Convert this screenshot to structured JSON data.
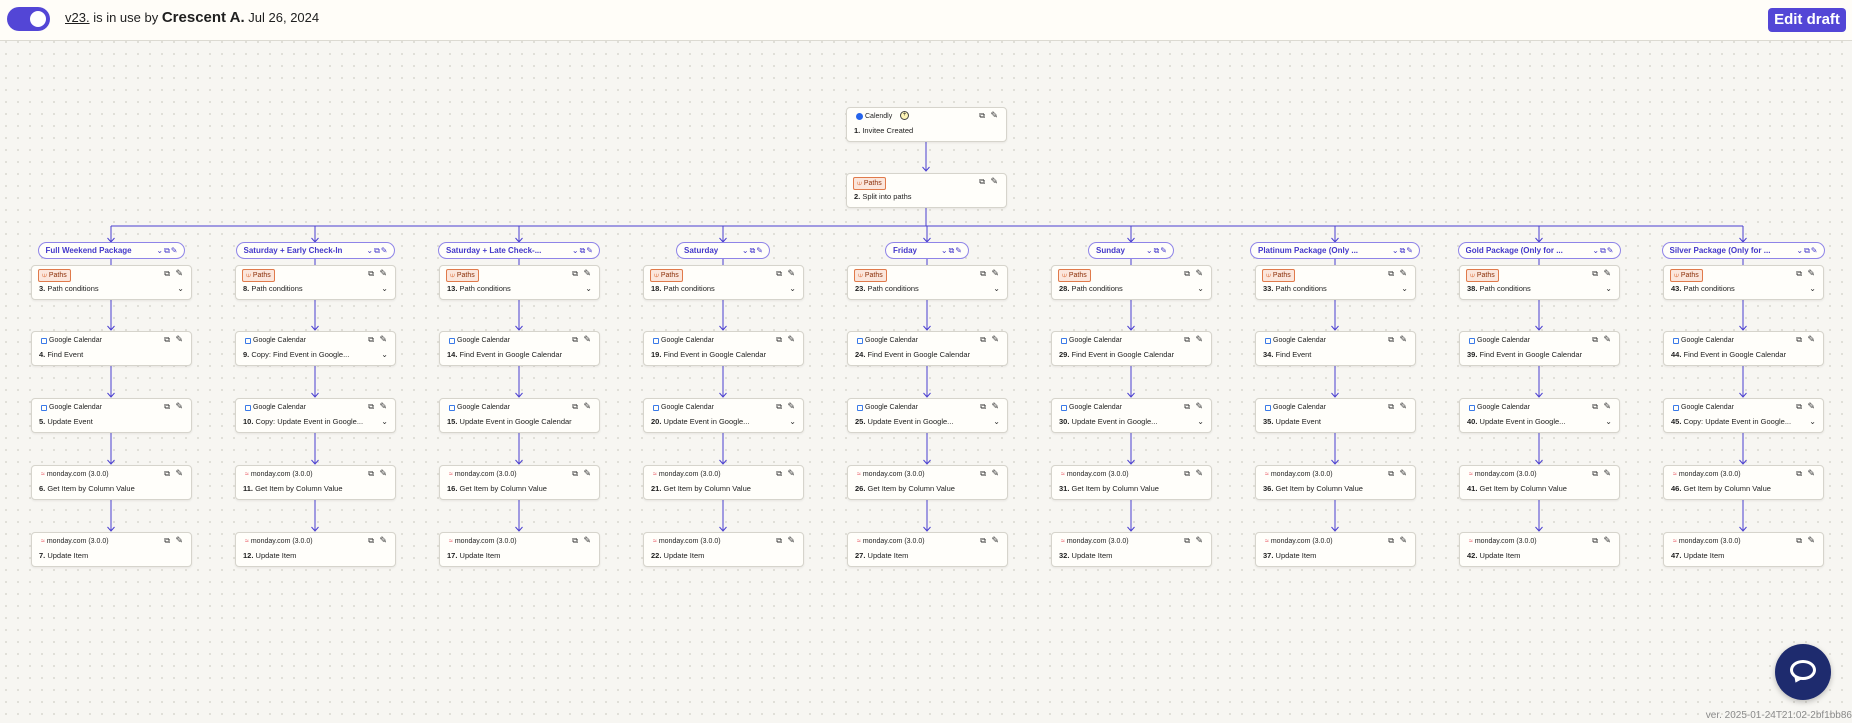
{
  "header": {
    "version": "v23.",
    "in_use_text": " is in use by ",
    "user": "Crescent A.",
    "date": "Jul 26, 2024",
    "edit_button": "Edit draft"
  },
  "colors": {
    "accent": "#5346d6",
    "branch_text": "#4338ca",
    "paths_orange": "#e07a4b"
  },
  "trigger": {
    "app": "Calendly",
    "app_icon": "calendly-icon",
    "num": "1.",
    "title": "Invitee Created"
  },
  "splitter": {
    "app": "Paths",
    "app_icon": "paths-icon",
    "num": "2.",
    "title": "Split into paths"
  },
  "branches": [
    {
      "name": "Full Weekend Package",
      "steps": [
        {
          "app": "Paths",
          "num": "3.",
          "title": "Path conditions",
          "chevron": true
        },
        {
          "app": "Google Calendar",
          "num": "4.",
          "title": "Find Event",
          "chevron": false
        },
        {
          "app": "Google Calendar",
          "num": "5.",
          "title": "Update Event",
          "chevron": false
        },
        {
          "app": "monday.com (3.0.0)",
          "num": "6.",
          "title": "Get Item by Column Value",
          "chevron": false
        },
        {
          "app": "monday.com (3.0.0)",
          "num": "7.",
          "title": "Update Item",
          "chevron": false
        }
      ]
    },
    {
      "name": "Saturday + Early Check-In",
      "steps": [
        {
          "app": "Paths",
          "num": "8.",
          "title": "Path conditions",
          "chevron": true
        },
        {
          "app": "Google Calendar",
          "num": "9.",
          "title": "Copy: Find Event in Google...",
          "chevron": true
        },
        {
          "app": "Google Calendar",
          "num": "10.",
          "title": "Copy: Update Event in Google...",
          "chevron": true
        },
        {
          "app": "monday.com (3.0.0)",
          "num": "11.",
          "title": "Get Item by Column Value",
          "chevron": false
        },
        {
          "app": "monday.com (3.0.0)",
          "num": "12.",
          "title": "Update Item",
          "chevron": false
        }
      ]
    },
    {
      "name": "Saturday + Late Check-...",
      "steps": [
        {
          "app": "Paths",
          "num": "13.",
          "title": "Path conditions",
          "chevron": true
        },
        {
          "app": "Google Calendar",
          "num": "14.",
          "title": "Find Event in Google Calendar",
          "chevron": false
        },
        {
          "app": "Google Calendar",
          "num": "15.",
          "title": "Update Event in Google Calendar",
          "chevron": false
        },
        {
          "app": "monday.com (3.0.0)",
          "num": "16.",
          "title": "Get Item by Column Value",
          "chevron": false
        },
        {
          "app": "monday.com (3.0.0)",
          "num": "17.",
          "title": "Update Item",
          "chevron": false
        }
      ]
    },
    {
      "name": "Saturday",
      "steps": [
        {
          "app": "Paths",
          "num": "18.",
          "title": "Path conditions",
          "chevron": true
        },
        {
          "app": "Google Calendar",
          "num": "19.",
          "title": "Find Event in Google Calendar",
          "chevron": false
        },
        {
          "app": "Google Calendar",
          "num": "20.",
          "title": "Update Event in Google...",
          "chevron": true
        },
        {
          "app": "monday.com (3.0.0)",
          "num": "21.",
          "title": "Get Item by Column Value",
          "chevron": false
        },
        {
          "app": "monday.com (3.0.0)",
          "num": "22.",
          "title": "Update Item",
          "chevron": false
        }
      ]
    },
    {
      "name": "Friday",
      "steps": [
        {
          "app": "Paths",
          "num": "23.",
          "title": "Path conditions",
          "chevron": true
        },
        {
          "app": "Google Calendar",
          "num": "24.",
          "title": "Find Event in Google Calendar",
          "chevron": false
        },
        {
          "app": "Google Calendar",
          "num": "25.",
          "title": "Update Event in Google...",
          "chevron": true
        },
        {
          "app": "monday.com (3.0.0)",
          "num": "26.",
          "title": "Get Item by Column Value",
          "chevron": false
        },
        {
          "app": "monday.com (3.0.0)",
          "num": "27.",
          "title": "Update Item",
          "chevron": false
        }
      ]
    },
    {
      "name": "Sunday",
      "steps": [
        {
          "app": "Paths",
          "num": "28.",
          "title": "Path conditions",
          "chevron": true
        },
        {
          "app": "Google Calendar",
          "num": "29.",
          "title": "Find Event in Google Calendar",
          "chevron": false
        },
        {
          "app": "Google Calendar",
          "num": "30.",
          "title": "Update Event in Google...",
          "chevron": true
        },
        {
          "app": "monday.com (3.0.0)",
          "num": "31.",
          "title": "Get Item by Column Value",
          "chevron": false
        },
        {
          "app": "monday.com (3.0.0)",
          "num": "32.",
          "title": "Update Item",
          "chevron": false
        }
      ]
    },
    {
      "name": "Platinum Package (Only ...",
      "steps": [
        {
          "app": "Paths",
          "num": "33.",
          "title": "Path conditions",
          "chevron": true
        },
        {
          "app": "Google Calendar",
          "num": "34.",
          "title": "Find Event",
          "chevron": false
        },
        {
          "app": "Google Calendar",
          "num": "35.",
          "title": "Update Event",
          "chevron": false
        },
        {
          "app": "monday.com (3.0.0)",
          "num": "36.",
          "title": "Get Item by Column Value",
          "chevron": false
        },
        {
          "app": "monday.com (3.0.0)",
          "num": "37.",
          "title": "Update Item",
          "chevron": false
        }
      ]
    },
    {
      "name": "Gold Package (Only for ...",
      "steps": [
        {
          "app": "Paths",
          "num": "38.",
          "title": "Path conditions",
          "chevron": true
        },
        {
          "app": "Google Calendar",
          "num": "39.",
          "title": "Find Event in Google Calendar",
          "chevron": false
        },
        {
          "app": "Google Calendar",
          "num": "40.",
          "title": "Update Event in Google...",
          "chevron": true
        },
        {
          "app": "monday.com (3.0.0)",
          "num": "41.",
          "title": "Get Item by Column Value",
          "chevron": false
        },
        {
          "app": "monday.com (3.0.0)",
          "num": "42.",
          "title": "Update Item",
          "chevron": false
        }
      ]
    },
    {
      "name": "Silver Package (Only for ...",
      "steps": [
        {
          "app": "Paths",
          "num": "43.",
          "title": "Path conditions",
          "chevron": true
        },
        {
          "app": "Google Calendar",
          "num": "44.",
          "title": "Find Event in Google Calendar",
          "chevron": false
        },
        {
          "app": "Google Calendar",
          "num": "45.",
          "title": "Copy: Update Event in Google...",
          "chevron": true
        },
        {
          "app": "monday.com (3.0.0)",
          "num": "46.",
          "title": "Get Item by Column Value",
          "chevron": false
        },
        {
          "app": "monday.com (3.0.0)",
          "num": "47.",
          "title": "Update Item",
          "chevron": false
        }
      ]
    }
  ],
  "footer": {
    "version_stamp": "ver. 2025-01-24T21:02-2bf1bb86"
  }
}
